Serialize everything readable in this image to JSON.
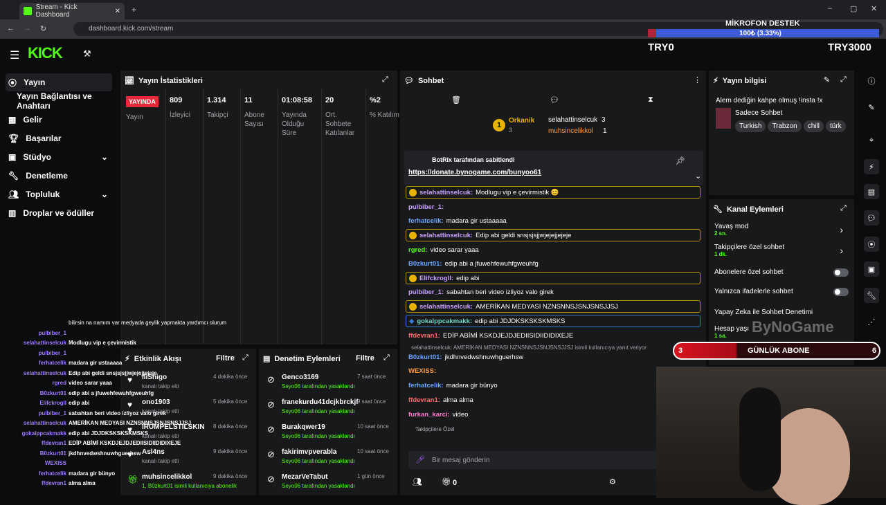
{
  "browser": {
    "tab_title": "Stream - Kick Dashboard",
    "url": "dashboard.kick.com/stream"
  },
  "header": {
    "logo": "KICK"
  },
  "overlay": {
    "mic_title": "MİKROFON DESTEK",
    "mic_value": "100₺ (3.33%)",
    "try_left": "TRY0",
    "try_right": "TRY3000",
    "daily_sub_count": "3",
    "daily_sub_label": "GÜNLÜK ABONE",
    "daily_sub_right": "6",
    "watermark": "ByNoGame"
  },
  "sidebar": {
    "items": [
      {
        "label": "Yayın"
      },
      {
        "label": "Yayın Bağlantısı ve Anahtarı"
      },
      {
        "label": "Gelir"
      },
      {
        "label": "Başarılar"
      },
      {
        "label": "Stüdyo"
      },
      {
        "label": "Denetleme"
      },
      {
        "label": "Topluluk"
      },
      {
        "label": "Droplar ve ödüller"
      }
    ]
  },
  "stats": {
    "title": "Yayın İstatistikleri",
    "live": "YAYINDA",
    "live_sub": "Yayın",
    "cols": [
      {
        "value": "809",
        "label": "İzleyici"
      },
      {
        "value": "1.314",
        "label": "Takipçi"
      },
      {
        "value": "11",
        "label": "Abone Sayısı"
      },
      {
        "value": "01:08:58",
        "label": "Yayında Olduğu Süre"
      },
      {
        "value": "20",
        "label": "Ort. Sohbete Katılanlar"
      },
      {
        "value": "%2",
        "label": "% Katılım"
      }
    ]
  },
  "activity": {
    "title": "Etkinlik Akışı",
    "filter": "Filtre",
    "items": [
      {
        "name": "iliShigo",
        "sub": "kanalı takip etti",
        "time": "4 dakika önce"
      },
      {
        "name": "ono1903",
        "sub": "kanalı takip etti",
        "time": "5 dakika önce"
      },
      {
        "name": "IRUMPELSTILSKIN",
        "sub": "kanalı takip etti",
        "time": "8 dakika önce"
      },
      {
        "name": "Asl4ns",
        "sub": "kanalı takip etti",
        "time": "9 dakika önce"
      },
      {
        "name": "muhsincelikkol",
        "sub": "1, B0zkurt01 isimli kullanıcıya abonelik",
        "time": "9 dakika önce"
      }
    ]
  },
  "moderation": {
    "title": "Denetim Eylemleri",
    "filter": "Filtre",
    "items": [
      {
        "name": "Genco3169",
        "sub": "Seyo06 tarafından yasaklandı",
        "time": "7 saat önce"
      },
      {
        "name": "franekurdu41dcjkbrckjfr",
        "sub": "Seyo06 tarafından yasaklandı",
        "time": "9 saat önce"
      },
      {
        "name": "Burakqwer19",
        "sub": "Seyo06 tarafından yasaklandı",
        "time": "10 saat önce"
      },
      {
        "name": "fakirimvpverabla",
        "sub": "Seyo06 tarafından yasaklandı",
        "time": "10 saat önce"
      },
      {
        "name": "MezarVeTabut",
        "sub": "Seyo06 tarafından yasaklandı",
        "time": "1 gün önce"
      }
    ]
  },
  "chat": {
    "title": "Sohbet",
    "leaders": [
      {
        "rank": "1",
        "name": "Orkanik",
        "count": "3"
      },
      {
        "name": "selahattinselcuk",
        "count": "3"
      },
      {
        "name": "muhsincelikkol",
        "count": "1"
      }
    ],
    "pinned_by": "BotRix tarafından sabitlendi",
    "pinned_link": "https://donate.bynogame.com/bunyoo61",
    "messages": [
      {
        "user": "selahattinselcuk:",
        "text": "Modlugu vip e çevirmistik 😊",
        "color": "#c9a0ff",
        "style": "gold"
      },
      {
        "user": "pulbiber_1:",
        "text": "",
        "color": "#c9a0ff",
        "style": ""
      },
      {
        "user": "ferhatcelik:",
        "text": "madara gir ustaaaaa",
        "color": "#6aa6ff",
        "style": ""
      },
      {
        "user": "selahattinselcuk:",
        "text": "Edip abi geldi snsjsjsjjwjejejjejeje",
        "color": "#c9a0ff",
        "style": "gold"
      },
      {
        "user": "rgred:",
        "text": "video sarar yaaa",
        "color": "#53fc18",
        "style": ""
      },
      {
        "user": "B0zkurt01:",
        "text": "edip abi a jfuwehfewuhfgweuhfg",
        "color": "#6aa6ff",
        "style": ""
      },
      {
        "user": "Elifckrogll:",
        "text": "edip abi",
        "color": "#c9a0ff",
        "style": "gold"
      },
      {
        "user": "pulbiber_1:",
        "text": "sabahtan beri video izliyoz valo girek",
        "color": "#c9a0ff",
        "style": ""
      },
      {
        "user": "selahattinselcuk:",
        "text": "AMERİKAN MEDYASI NZNSNNSJSNJSNSJJSJ",
        "color": "#c9a0ff",
        "style": "gold"
      },
      {
        "user": "gokalppcakmakk:",
        "text": "edip abi JDJDKSKSKSKMSKS",
        "color": "#6ad6c8",
        "style": "blue"
      },
      {
        "user": "ffdevran1:",
        "text": "EDİP ABİMİ KSKDJEJDJEDIISIDIIDIDIXEJE",
        "color": "#ff6b6b",
        "style": ""
      },
      {
        "user": "B0zkurt01:",
        "text": "jkdhnvedwshnuwhguerhsw",
        "color": "#6aa6ff",
        "style": ""
      },
      {
        "user": "WEXISS:",
        "text": "",
        "color": "#ff9a3c",
        "style": ""
      },
      {
        "user": "ferhatcelik:",
        "text": "madara gir bünyo",
        "color": "#6aa6ff",
        "style": ""
      },
      {
        "user": "ffdevran1:",
        "text": "alma alma",
        "color": "#ff6b6b",
        "style": ""
      },
      {
        "user": "furkan_karci:",
        "text": "video",
        "color": "#ff7bd1",
        "style": ""
      }
    ],
    "reply_note": "selahattinselcuk: AMERİKAN MEDYASI NZNSNNSJSNJSNSJJSJ isimli kullanıcıya yanıt veriyor",
    "followers_only": "Takipçilere Özel",
    "input_placeholder": "Bir mesaj gönderin",
    "footer_count": "0"
  },
  "stream_info": {
    "title": "Yayın bilgisi",
    "stream_title": "Alem dediğin kahpe olmuş !insta !x",
    "category": "Sadece Sohbet",
    "tags": [
      "Turkish",
      "Trabzon",
      "chill",
      "türk"
    ]
  },
  "channel_actions": {
    "title": "Kanal Eylemleri",
    "slow": "Yavaş mod",
    "slow_val": "2 sn.",
    "followers": "Takipçilere özel sohbet",
    "followers_val": "1 dk.",
    "subs": "Abonelere özel sohbet",
    "emotes": "Yalnızca ifadelerle sohbet",
    "ai": "Yapay Zeka ile Sohbet Denetimi",
    "account": "Hesap yaşı",
    "account_val": "1 sa."
  },
  "overlay_chat": [
    {
      "user": "",
      "text": "bilirsin na namım var medyada geylik yapmakta yardımcı olurum"
    },
    {
      "user": "pulbiber_1",
      "text": ""
    },
    {
      "user": "selahattinselcuk",
      "text": "Modlugu vip e çevirmistik"
    },
    {
      "user": "pulbiber_1",
      "text": ""
    },
    {
      "user": "ferhatcelik",
      "text": "madara gir ustaaaaa"
    },
    {
      "user": "selahattinselcuk",
      "text": "Edip abi geldi snsjsjsjjwjejejjejeje"
    },
    {
      "user": "rgred",
      "text": "video sarar yaaa"
    },
    {
      "user": "B0zkurt01",
      "text": "edip abi a jfuwehfewuhfgweuhfg"
    },
    {
      "user": "Elifckrogll",
      "text": "edip abi"
    },
    {
      "user": "pulbiber_1",
      "text": "sabahtan beri video izliyoz valo girek"
    },
    {
      "user": "selahattinselcuk",
      "text": "AMERİKAN MEDYASI NZNSNNSJSNJSNSJJSJ"
    },
    {
      "user": "gokalppcakmakk",
      "text": "edip abi JDJDKSKSKSKMSKS"
    },
    {
      "user": "ffdevran1",
      "text": "EDİP ABİMİ KSKDJEJDJEDIISIDIIDIDIXEJE"
    },
    {
      "user": "B0zkurt01",
      "text": "jkdhnvedwshnuwhguerhsw"
    },
    {
      "user": "WEXISS",
      "text": ""
    },
    {
      "user": "ferhatcelik",
      "text": "madara gir bünyo"
    },
    {
      "user": "ffdevran1",
      "text": "alma alma"
    }
  ]
}
